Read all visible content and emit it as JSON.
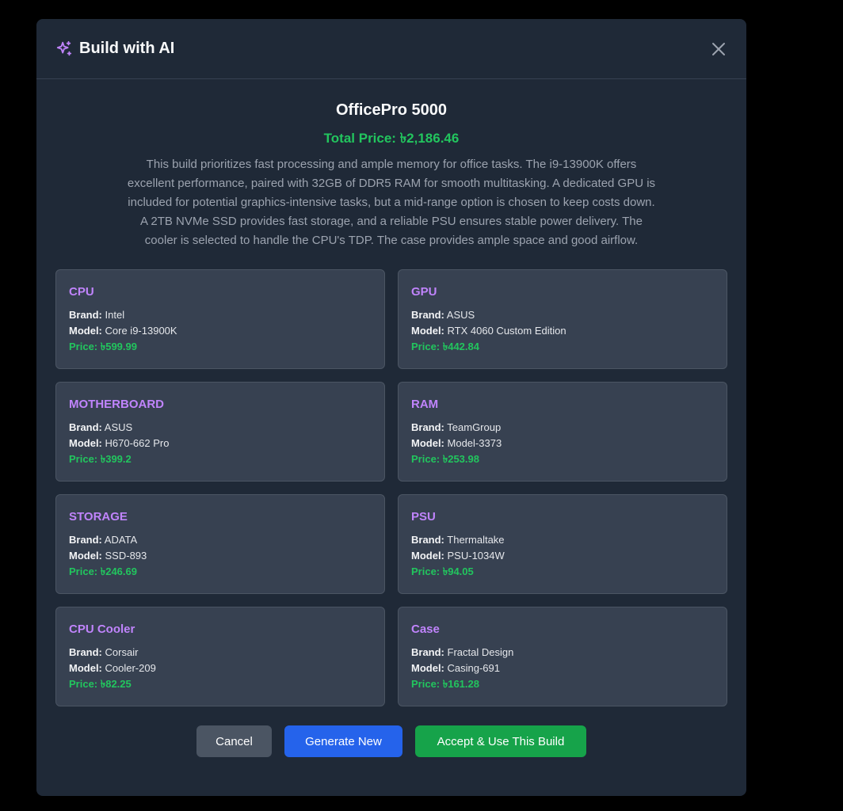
{
  "header": {
    "title": "Build with AI",
    "sparkle_icon": "sparkle-icon",
    "close_icon": "close-icon"
  },
  "build": {
    "name": "OfficePro 5000",
    "total_price": "Total Price: ৳2,186.46",
    "description": "This build prioritizes fast processing and ample memory for office tasks. The i9-13900K offers excellent performance, paired with 32GB of DDR5 RAM for smooth multitasking. A dedicated GPU is included for potential graphics-intensive tasks, but a mid-range option is chosen to keep costs down. A 2TB NVMe SSD provides fast storage, and a reliable PSU ensures stable power delivery. The cooler is selected to handle the CPU's TDP. The case provides ample space and good airflow."
  },
  "labels": {
    "brand": "Brand:",
    "model": "Model:"
  },
  "components": [
    {
      "type": "CPU",
      "brand": "Intel",
      "model": "Core i9-13900K",
      "price": "Price: ৳599.99"
    },
    {
      "type": "GPU",
      "brand": "ASUS",
      "model": "RTX 4060 Custom Edition",
      "price": "Price: ৳442.84"
    },
    {
      "type": "MOTHERBOARD",
      "brand": "ASUS",
      "model": "H670-662 Pro",
      "price": "Price: ৳399.2"
    },
    {
      "type": "RAM",
      "brand": "TeamGroup",
      "model": "Model-3373",
      "price": "Price: ৳253.98"
    },
    {
      "type": "STORAGE",
      "brand": "ADATA",
      "model": "SSD-893",
      "price": "Price: ৳246.69"
    },
    {
      "type": "PSU",
      "brand": "Thermaltake",
      "model": "PSU-1034W",
      "price": "Price: ৳94.05"
    },
    {
      "type": "CPU Cooler",
      "brand": "Corsair",
      "model": "Cooler-209",
      "price": "Price: ৳82.25"
    },
    {
      "type": "Case",
      "brand": "Fractal Design",
      "model": "Casing-691",
      "price": "Price: ৳161.28"
    }
  ],
  "footer": {
    "cancel_label": "Cancel",
    "generate_label": "Generate New",
    "accept_label": "Accept & Use This Build"
  },
  "colors": {
    "modal_bg": "#1f2937",
    "card_bg": "#374151",
    "accent_purple": "#c084fc",
    "price_green": "#22c55e",
    "cancel_bg": "#4b5563",
    "generate_bg": "#2563eb",
    "accept_bg": "#16a34a"
  }
}
